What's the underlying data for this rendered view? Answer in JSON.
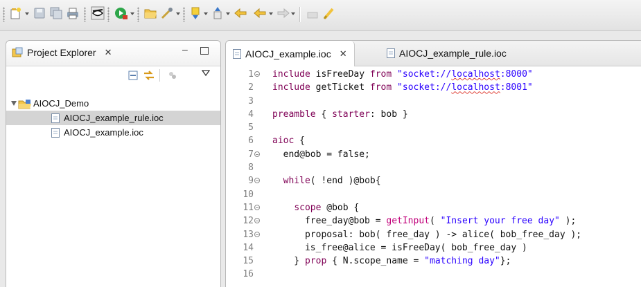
{
  "toolbar": {
    "buttons": [
      "new-icon",
      "save-icon",
      "save-all-icon",
      "print-icon",
      "eye-icon",
      "run-icon",
      "open-folder-icon",
      "tools-icon",
      "next-annotation-icon",
      "prev-annotation-icon",
      "back-icon",
      "forward-icon",
      "last-edit-icon",
      "brush-icon"
    ]
  },
  "project_explorer": {
    "title": "Project Explorer",
    "close_symbol": "✕",
    "minimize_symbol": "–",
    "tree": {
      "project": "AIOCJ_Demo",
      "files": [
        {
          "name": "AIOCJ_example_rule.ioc",
          "selected": true
        },
        {
          "name": "AIOCJ_example.ioc",
          "selected": false
        }
      ]
    }
  },
  "editor": {
    "tabs": [
      {
        "label": "AIOCJ_example.ioc",
        "active": true,
        "close_symbol": "✕"
      },
      {
        "label": "AIOCJ_example_rule.ioc",
        "active": false
      }
    ],
    "lines": [
      {
        "n": "1",
        "fold": true,
        "tokens": [
          [
            "kw",
            "include "
          ],
          [
            "plain",
            "isFreeDay "
          ],
          [
            "kw",
            "from "
          ],
          [
            "str",
            "\"socket://"
          ],
          [
            "strsq",
            "localhost"
          ],
          [
            "str",
            ":8000\""
          ]
        ]
      },
      {
        "n": "2",
        "fold": false,
        "tokens": [
          [
            "kw",
            "include "
          ],
          [
            "plain",
            "getTicket "
          ],
          [
            "kw",
            "from "
          ],
          [
            "str",
            "\"socket://"
          ],
          [
            "strsq",
            "localhost"
          ],
          [
            "str",
            ":8001\""
          ]
        ]
      },
      {
        "n": "3",
        "fold": false,
        "tokens": []
      },
      {
        "n": "4",
        "fold": false,
        "tokens": [
          [
            "kw",
            "preamble "
          ],
          [
            "plain",
            "{ "
          ],
          [
            "kw",
            "starter"
          ],
          [
            "plain",
            ": bob }"
          ]
        ]
      },
      {
        "n": "5",
        "fold": false,
        "tokens": []
      },
      {
        "n": "6",
        "fold": false,
        "tokens": [
          [
            "kw",
            "aioc "
          ],
          [
            "plain",
            "{"
          ]
        ]
      },
      {
        "n": "7",
        "fold": true,
        "tokens": [
          [
            "plain",
            "  end@bob = false;"
          ]
        ]
      },
      {
        "n": "8",
        "fold": false,
        "tokens": []
      },
      {
        "n": "9",
        "fold": true,
        "tokens": [
          [
            "plain",
            "  "
          ],
          [
            "kw",
            "while"
          ],
          [
            "plain",
            "( !end )@bob{"
          ]
        ]
      },
      {
        "n": "10",
        "fold": false,
        "tokens": []
      },
      {
        "n": "11",
        "fold": true,
        "tokens": [
          [
            "plain",
            "    "
          ],
          [
            "kw",
            "scope "
          ],
          [
            "plain",
            "@bob {"
          ]
        ]
      },
      {
        "n": "12",
        "fold": true,
        "tokens": [
          [
            "plain",
            "      free_day@bob = "
          ],
          [
            "fn",
            "getInput"
          ],
          [
            "plain",
            "( "
          ],
          [
            "str",
            "\"Insert your free day\""
          ],
          [
            "plain",
            " );"
          ]
        ]
      },
      {
        "n": "13",
        "fold": true,
        "tokens": [
          [
            "plain",
            "      proposal: bob( free_day ) -> alice( bob_free_day );"
          ]
        ]
      },
      {
        "n": "14",
        "fold": false,
        "tokens": [
          [
            "plain",
            "      is_free@alice = isFreeDay( bob_free_day )"
          ]
        ]
      },
      {
        "n": "15",
        "fold": false,
        "tokens": [
          [
            "plain",
            "    } "
          ],
          [
            "kw",
            "prop "
          ],
          [
            "plain",
            "{ N.scope_name = "
          ],
          [
            "str",
            "\"matching day\""
          ],
          [
            "plain",
            "};"
          ]
        ]
      },
      {
        "n": "16",
        "fold": false,
        "tokens": []
      }
    ]
  }
}
